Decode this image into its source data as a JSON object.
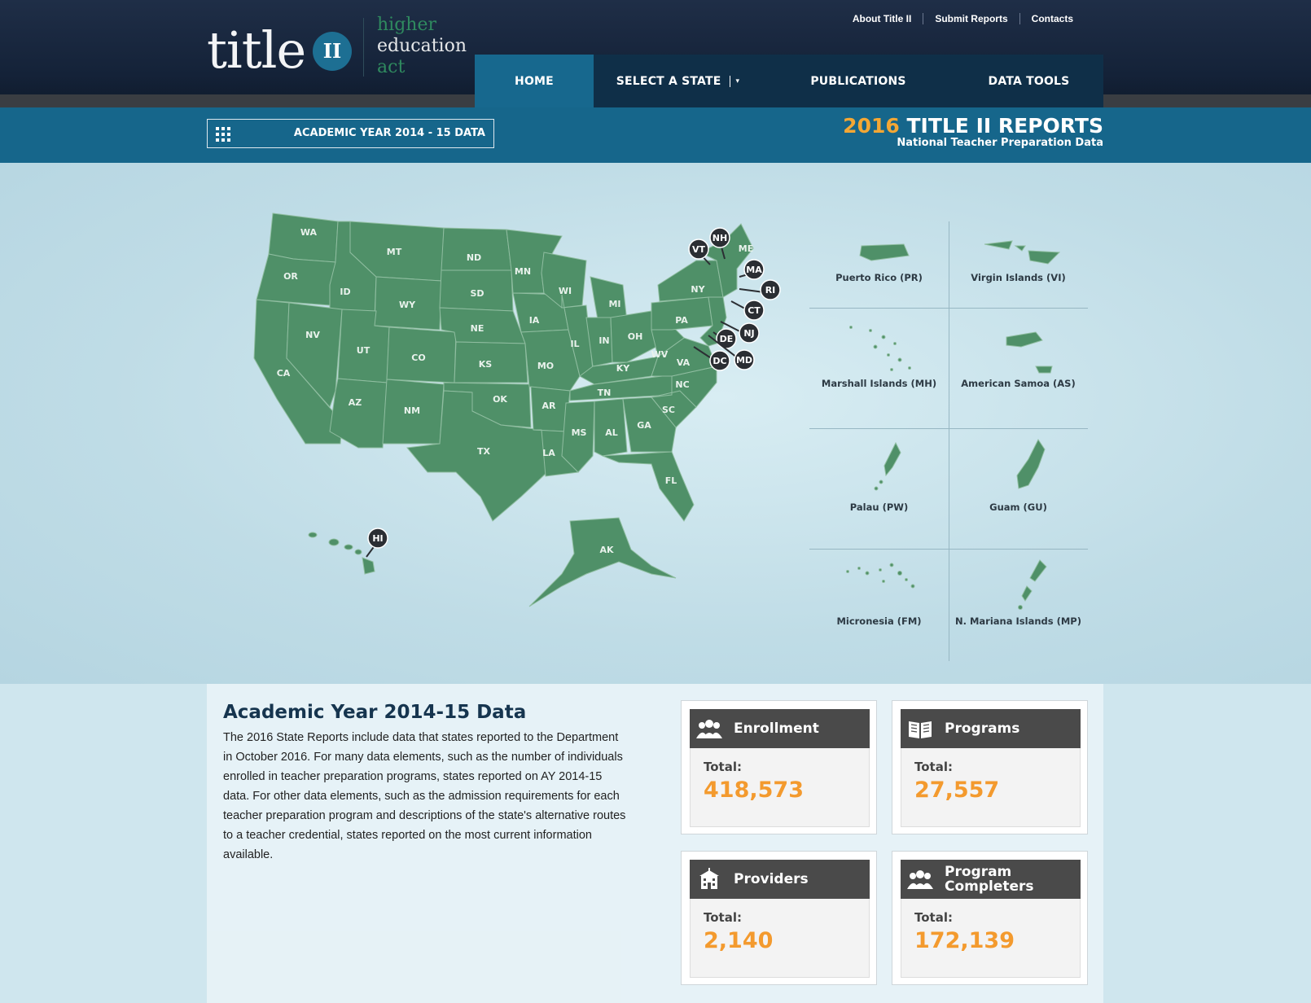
{
  "header": {
    "logo": {
      "word": "title",
      "numeral": "II",
      "sub": [
        "higher",
        "education",
        "act"
      ]
    },
    "utility_nav": [
      "About Title II",
      "Submit Reports",
      "Contacts"
    ],
    "main_nav": {
      "home": "HOME",
      "select_state": "SELECT A STATE",
      "publications": "PUBLICATIONS",
      "data_tools": "DATA TOOLS"
    }
  },
  "subbar": {
    "year_button": "ACADEMIC YEAR 2014 - 15 DATA",
    "report_year": "2016",
    "report_title": " TITLE II REPORTS",
    "report_subtitle": "National Teacher Preparation Data"
  },
  "map": {
    "states": [
      "WA",
      "OR",
      "CA",
      "ID",
      "NV",
      "MT",
      "WY",
      "UT",
      "AZ",
      "CO",
      "NM",
      "ND",
      "SD",
      "NE",
      "KS",
      "OK",
      "TX",
      "MN",
      "IA",
      "MO",
      "AR",
      "LA",
      "WI",
      "IL",
      "MI",
      "IN",
      "OH",
      "KY",
      "TN",
      "MS",
      "AL",
      "GA",
      "FL",
      "SC",
      "NC",
      "VA",
      "WV",
      "PA",
      "NY",
      "ME",
      "AK"
    ],
    "pins": [
      "VT",
      "NH",
      "MA",
      "RI",
      "CT",
      "NJ",
      "DE",
      "MD",
      "DC",
      "HI"
    ],
    "territories": [
      "Puerto Rico (PR)",
      "Virgin Islands (VI)",
      "Marshall Islands (MH)",
      "American Samoa (AS)",
      "Palau (PW)",
      "Guam (GU)",
      "Micronesia (FM)",
      "N. Mariana Islands (MP)"
    ]
  },
  "info": {
    "title": "Academic Year 2014-15 Data",
    "body": "The 2016 State Reports include data that states reported to the Department in October 2016. For many data elements, such as the number of individuals enrolled in teacher preparation programs, states reported on AY 2014-15 data. For other data elements, such as the admission requirements for each teacher preparation program and descriptions of the state's alternative routes to a teacher credential, states reported on the most current information available."
  },
  "stats": [
    {
      "name": "Enrollment",
      "total_label": "Total:",
      "value": "418,573",
      "icon": "people-icon"
    },
    {
      "name": "Programs",
      "total_label": "Total:",
      "value": "27,557",
      "icon": "book-icon"
    },
    {
      "name": "Providers",
      "total_label": "Total:",
      "value": "2,140",
      "icon": "building-icon"
    },
    {
      "name": "Program Completers",
      "total_label": "Total:",
      "value": "172,139",
      "icon": "people-icon"
    }
  ],
  "colors": {
    "accent_orange": "#f39a2e",
    "nav_blue": "#17688e",
    "map_green": "#4f9068"
  }
}
